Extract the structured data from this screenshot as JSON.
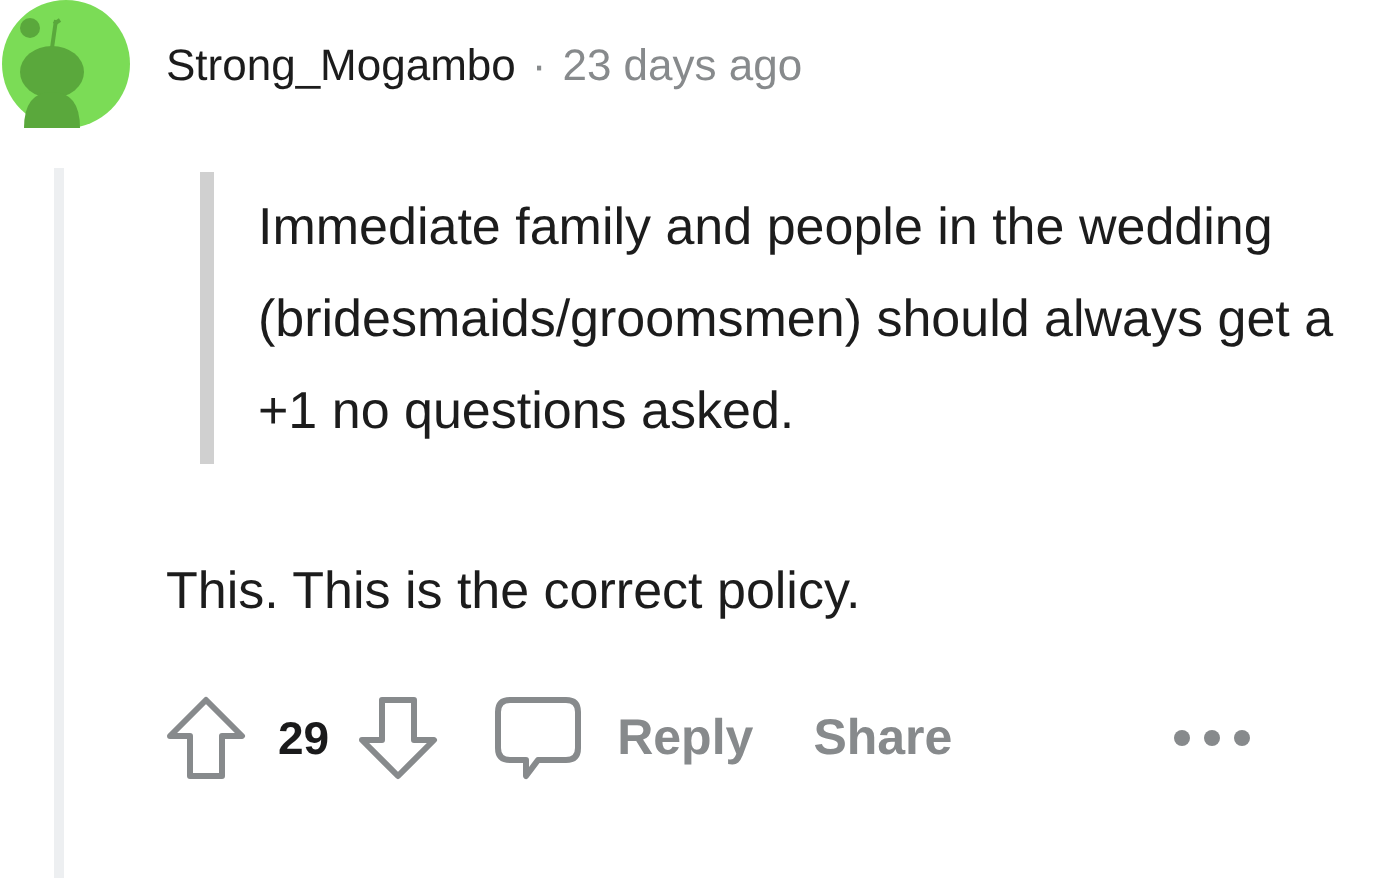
{
  "comment": {
    "author": "Strong_Mogambo",
    "separator": "·",
    "time": "23 days ago",
    "quote": "Immediate family and people in the wedding (bridesmaids/groomsmen) should always get a +1 no questions asked.",
    "body": "This. This is the correct policy.",
    "score": "29",
    "actions": [
      "Reply",
      "Share"
    ]
  }
}
